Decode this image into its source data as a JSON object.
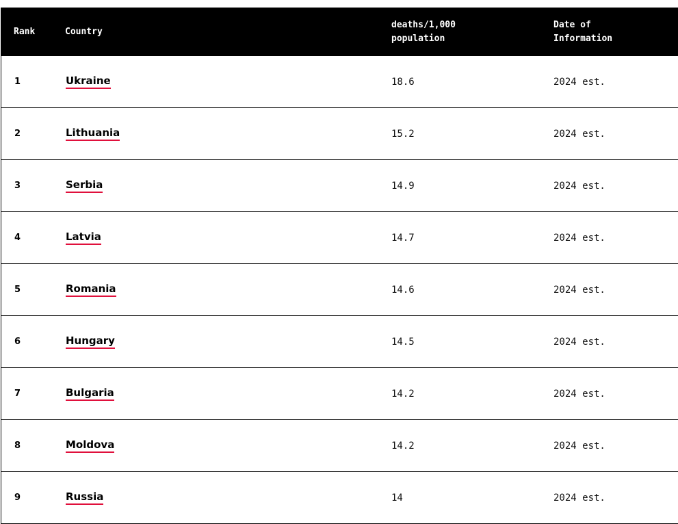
{
  "table": {
    "headers": {
      "rank": "Rank",
      "country": "Country",
      "value_line1": "deaths/1,000",
      "value_line2": "population",
      "date_line1": "Date of",
      "date_line2": "Information"
    },
    "link_underline_color": "#e0103c",
    "rows": [
      {
        "rank": "1",
        "country": "Ukraine",
        "value": "18.6",
        "date": "2024 est."
      },
      {
        "rank": "2",
        "country": "Lithuania",
        "value": "15.2",
        "date": "2024 est."
      },
      {
        "rank": "3",
        "country": "Serbia",
        "value": "14.9",
        "date": "2024 est."
      },
      {
        "rank": "4",
        "country": "Latvia",
        "value": "14.7",
        "date": "2024 est."
      },
      {
        "rank": "5",
        "country": "Romania",
        "value": "14.6",
        "date": "2024 est."
      },
      {
        "rank": "6",
        "country": "Hungary",
        "value": "14.5",
        "date": "2024 est."
      },
      {
        "rank": "7",
        "country": "Bulgaria",
        "value": "14.2",
        "date": "2024 est."
      },
      {
        "rank": "8",
        "country": "Moldova",
        "value": "14.2",
        "date": "2024 est."
      },
      {
        "rank": "9",
        "country": "Russia",
        "value": "14",
        "date": "2024 est."
      }
    ]
  }
}
